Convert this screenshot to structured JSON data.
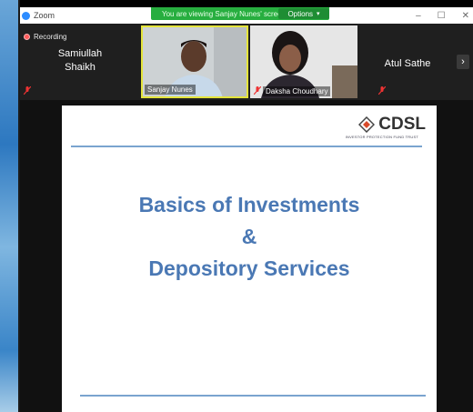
{
  "window": {
    "app_name": "Zoom"
  },
  "share_banner": {
    "message": "You are viewing Sanjay Nunes' screen",
    "options_label": "Options"
  },
  "window_controls": {
    "minimize": "–",
    "maximize": "☐",
    "close": "✕"
  },
  "recording": {
    "label": "Recording"
  },
  "participants": [
    {
      "name_line1": "Samiullah",
      "name_line2": "Shaikh"
    },
    {
      "name": "Sanjay Nunes"
    },
    {
      "name": "Daksha Choudhary"
    },
    {
      "name": "Atul Sathe"
    }
  ],
  "gallery": {
    "next_icon": "›"
  },
  "slide": {
    "logo_text": "CDSL",
    "logo_sub": "INVESTOR PROTECTION FUND TRUST",
    "title_line1": "Basics of Investments",
    "title_line2": "&",
    "title_line3": "Depository Services"
  },
  "colors": {
    "banner_green": "#27ae3f",
    "accent_blue": "#4a78b4",
    "recording_red": "#ff5a5a"
  }
}
